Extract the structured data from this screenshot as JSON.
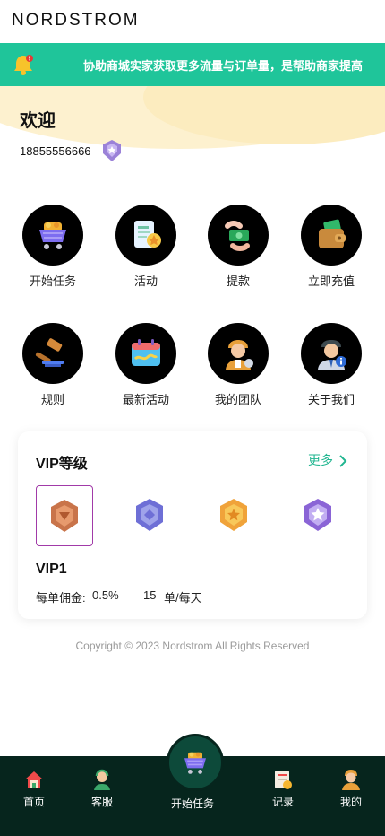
{
  "header": {
    "logo": "NORDSTROM"
  },
  "notice": {
    "text": "协助商城实家获取更多流量与订单量，是帮助商家提高",
    "icon": "bell-icon"
  },
  "user": {
    "welcome": "欢迎",
    "phone": "18855556666"
  },
  "menu": [
    {
      "label": "开始任务",
      "icon": "shopping-cart-icon"
    },
    {
      "label": "活动",
      "icon": "activity-doc-icon"
    },
    {
      "label": "提款",
      "icon": "withdraw-money-icon"
    },
    {
      "label": "立即充值",
      "icon": "wallet-icon"
    },
    {
      "label": "规则",
      "icon": "gavel-icon"
    },
    {
      "label": "最新活动",
      "icon": "calendar-icon"
    },
    {
      "label": "我的团队",
      "icon": "team-icon"
    },
    {
      "label": "关于我们",
      "icon": "about-icon"
    }
  ],
  "vip": {
    "title": "VIP等级",
    "more": "更多",
    "badges": [
      "bronze-badge-icon",
      "silver-badge-icon",
      "gold-badge-icon",
      "diamond-badge-icon"
    ],
    "selected_level": "VIP1",
    "commission_label": "每单佣金:",
    "commission_value": "0.5%",
    "orders_count": "15",
    "orders_unit": "单/每天"
  },
  "footer": {
    "copyright": "Copyright © 2023 Nordstrom All Rights Reserved"
  },
  "tabbar": {
    "home": "首页",
    "service": "客服",
    "start": "开始任务",
    "records": "记录",
    "mine": "我的"
  },
  "colors": {
    "accent": "#1fc59a",
    "tabbar": "#06251d",
    "selected_border": "#a13aa8"
  }
}
